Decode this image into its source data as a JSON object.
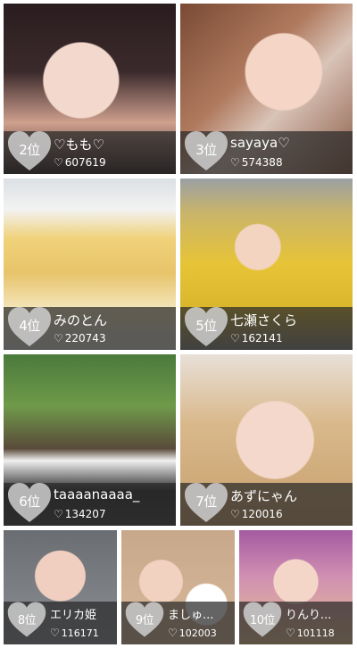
{
  "cards": [
    {
      "rank": "2位",
      "name": "♡もも♡",
      "likes": "607619",
      "photo_icon": "portrait-photo"
    },
    {
      "rank": "3位",
      "name": "sayaya♡",
      "likes": "574388",
      "photo_icon": "portrait-photo"
    },
    {
      "rank": "4位",
      "name": "みのとん",
      "likes": "220743",
      "photo_icon": "bread-package-photo"
    },
    {
      "rank": "5位",
      "name": "七瀬さくら",
      "likes": "162141",
      "photo_icon": "selfie-photo"
    },
    {
      "rank": "6位",
      "name": "taaaanaaaa_",
      "likes": "134207",
      "photo_icon": "portrait-photo"
    },
    {
      "rank": "7位",
      "name": "あずにゃん",
      "likes": "120016",
      "photo_icon": "portrait-photo"
    },
    {
      "rank": "8位",
      "name": "エリカ姫",
      "likes": "116171",
      "photo_icon": "portrait-photo"
    },
    {
      "rank": "9位",
      "name": "ましゅ...",
      "likes": "102003",
      "photo_icon": "portrait-photo"
    },
    {
      "rank": "10位",
      "name": "りんり...",
      "likes": "101118",
      "photo_icon": "portrait-photo"
    }
  ],
  "like_icon": "heart-outline-icon",
  "rank_badge_icon": "heart-badge-icon",
  "colors": {
    "overlay": "#282828",
    "badge": "#c8c8c8",
    "text": "#ffffff"
  }
}
